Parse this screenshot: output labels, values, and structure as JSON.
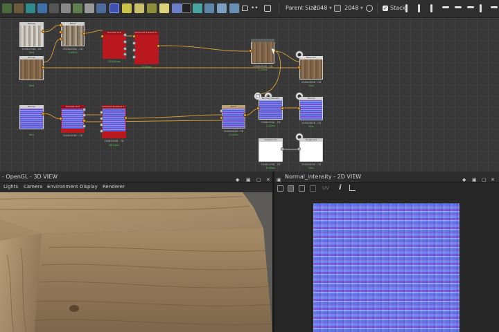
{
  "toolbar": {
    "parent_size_label": "Parent Size:",
    "parent_size_value": "2048",
    "size_value": "2048",
    "stack_label": "Stack",
    "stack_checked": true
  },
  "graph": {
    "nodes": [
      {
        "title": "Bitmap",
        "res": "2048x2048 - C8",
        "time": "0ms"
      },
      {
        "title": "Blend",
        "res": "2048x2048 - C8",
        "time": "0.09ms"
      },
      {
        "title": "Quantize Grid",
        "res": "",
        "time": "214.00ms"
      },
      {
        "title": "Advanced Gradient C...",
        "res": "",
        "time": "17.60ms"
      },
      {
        "title": "Bitmap",
        "res": "2048x2048 - C8",
        "time": "0ms"
      },
      {
        "title": "",
        "res": "2048x2048 - C8",
        "time": "1.17ms"
      },
      {
        "title": "Basecolor",
        "res": "2048x2048 - C8",
        "time": "0ms"
      },
      {
        "title": "Bitmap",
        "res": "2048x2048 - C8",
        "time": "0ms"
      },
      {
        "title": "Quantize Grid",
        "res": "2048x2048 - C8",
        "time": ""
      },
      {
        "title": "Advanced Gradient C...",
        "res": "2048x2048 - C8",
        "time": "18.24ms"
      },
      {
        "title": "Blend",
        "res": "2048x2048 - C8",
        "time": "0.11ms"
      },
      {
        "title": "Normal_intensity",
        "res": "2048x2048 - C8",
        "time": "1.40ms"
      },
      {
        "title": "Normal",
        "res": "2048x2048 - C8",
        "time": "0ms"
      },
      {
        "title": "Ambient Occ",
        "res": "2048x2048 - C8",
        "time": "0.06ms"
      },
      {
        "title": "Roughness",
        "res": "2048x2048 - C8",
        "time": "0ms"
      }
    ]
  },
  "panel3d": {
    "title": "- OpenGL - 3D VIEW",
    "menus": [
      "Lights",
      "Camera",
      "Environment",
      "Display",
      "Renderer"
    ]
  },
  "panel2d": {
    "title": "Normal_intensity - 2D VIEW",
    "uv_label": "UV"
  },
  "colors": {
    "accent_orange": "#e8a035",
    "node_red": "#b8181e",
    "time_green": "#4fd24f"
  }
}
